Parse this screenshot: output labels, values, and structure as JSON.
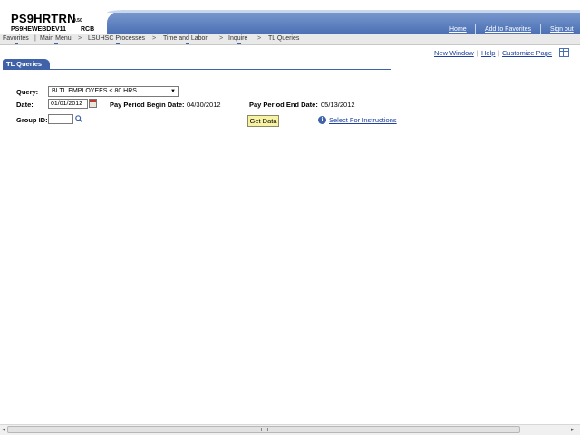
{
  "header": {
    "app_name": "PS9HRTRN",
    "version": "9.50",
    "database": "PS9HEWEBDEV11",
    "user": "RCB",
    "links": {
      "home": "Home",
      "favorites": "Add to Favorites",
      "signout": "Sign out"
    }
  },
  "nav": {
    "items": [
      "Favorites",
      "Main Menu",
      "LSUHSC Processes",
      "Time and Labor",
      "Inquire",
      "TL Queries"
    ],
    "separator": ">"
  },
  "page_links": {
    "new_window": "New Window",
    "help": "Help",
    "customize": "Customize Page"
  },
  "tab": {
    "label": "TL Queries"
  },
  "form": {
    "query_label": "Query:",
    "query_value": "BI TL EMPLOYEES < 80 HRS",
    "date_label": "Date:",
    "date_value": "01/01/2012",
    "begin_label": "Pay Period Begin Date:",
    "begin_value": "04/30/2012",
    "end_label": "Pay Period End Date:",
    "end_value": "05/13/2012",
    "group_label": "Group ID:",
    "group_value": "",
    "get_data": "Get Data",
    "instructions": "Select For Instructions"
  },
  "icons": {
    "calendar": "calendar-icon",
    "lookup": "magnifier-icon",
    "info": "info-icon",
    "grid": "grid-icon",
    "dropdown": "chevron-down-icon"
  },
  "colors": {
    "header_blue": "#4a6fb3",
    "tab_blue": "#3f62a8",
    "link_blue": "#1d3f9d",
    "button_yellow": "#f8f3a4"
  }
}
